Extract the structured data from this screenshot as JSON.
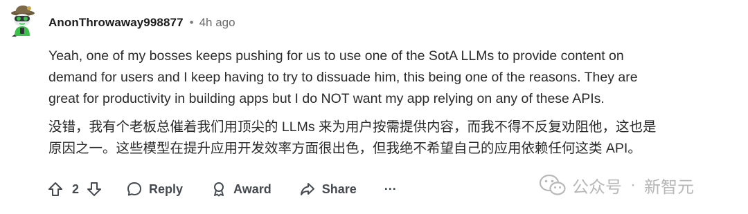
{
  "comment": {
    "username": "AnonThrowaway998877",
    "separator": "•",
    "time": "4h ago",
    "body_en": [
      "Yeah, one of my bosses keeps pushing for us to use one of the SotA LLMs to provide content on",
      "demand for users and I keep having to try to dissuade him, this being one of the reasons. They are",
      "great for productivity in building apps but I do NOT want my app relying on any of these APIs."
    ],
    "body_cn": [
      "没错，我有个老板总催着我们用顶尖的 LLMs 来为用户按需提供内容，而我不得不反复劝阻他，这也是",
      "原因之一。这些模型在提升应用开发效率方面很出色，但我绝不希望自己的应用依赖任何这类 API。"
    ]
  },
  "actions": {
    "vote_count": "2",
    "reply_label": "Reply",
    "award_label": "Award",
    "share_label": "Share",
    "more_label": "···"
  },
  "watermark": {
    "name": "公众号",
    "separator": "·",
    "brand": "新智元"
  },
  "colors": {
    "avatar_green": "#3cc14a",
    "icon_gray": "#444a4f",
    "watermark_gray": "#b8b8b8"
  }
}
